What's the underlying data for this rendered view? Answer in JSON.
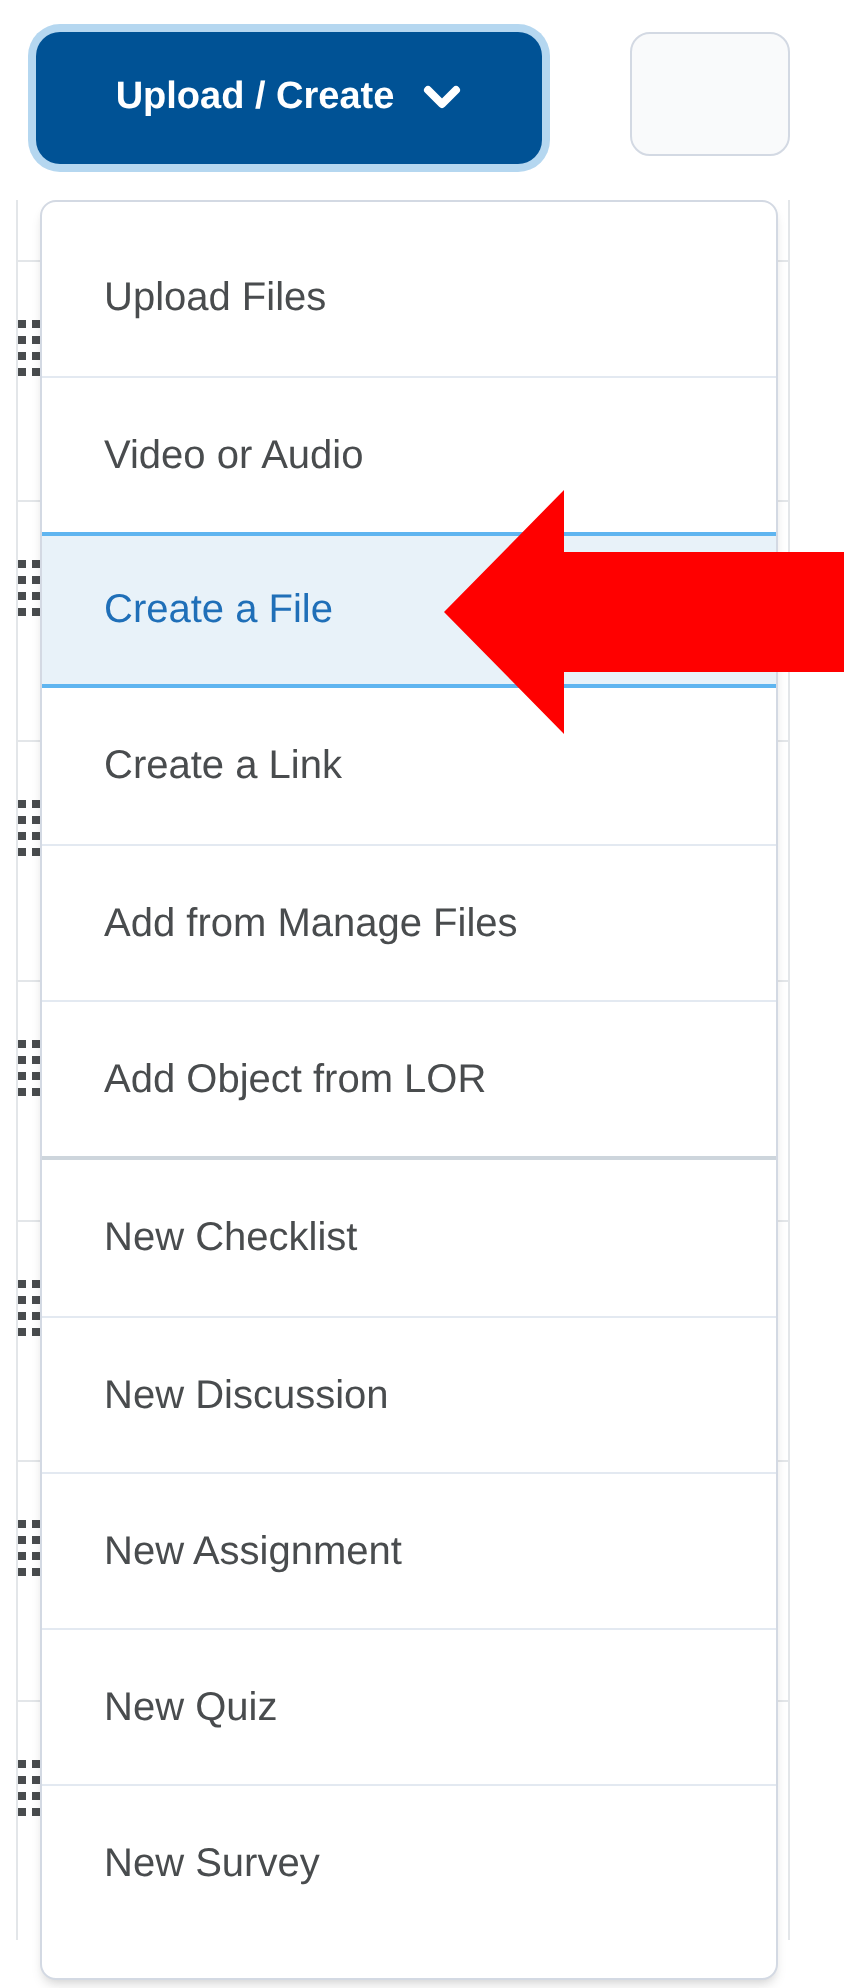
{
  "toolbar": {
    "primary_button": {
      "label": "Upload / Create",
      "expanded": true
    }
  },
  "menu": {
    "groups": [
      [
        {
          "label": "Upload Files",
          "selected": false
        },
        {
          "label": "Video or Audio",
          "selected": false
        },
        {
          "label": "Create a File",
          "selected": true
        },
        {
          "label": "Create a Link",
          "selected": false
        },
        {
          "label": "Add from Manage Files",
          "selected": false
        },
        {
          "label": "Add Object from LOR",
          "selected": false
        }
      ],
      [
        {
          "label": "New Checklist",
          "selected": false
        },
        {
          "label": "New Discussion",
          "selected": false
        },
        {
          "label": "New Assignment",
          "selected": false
        },
        {
          "label": "New Quiz",
          "selected": false
        },
        {
          "label": "New Survey",
          "selected": false
        }
      ]
    ]
  }
}
